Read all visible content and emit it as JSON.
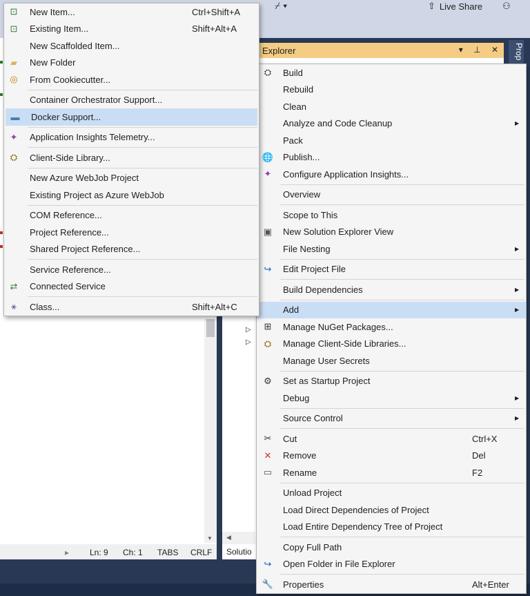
{
  "toolbar": {
    "live_share_label": "Live Share",
    "icons": [
      "live-share-icon",
      "person-icon",
      "toolbar-tool-icon"
    ]
  },
  "status_bar": {
    "ln": "Ln: 9",
    "ch": "Ch: 1",
    "tabs": "TABS",
    "crlf": "CRLF"
  },
  "solution_explorer": {
    "title": "Explorer",
    "tab_label": "Solutio",
    "controls": [
      "▾",
      "ᵽ",
      "✕"
    ]
  },
  "properties_tab": "Prop",
  "context_menu": {
    "items": [
      {
        "label": "Build",
        "icon": "build-icon"
      },
      {
        "label": "Rebuild"
      },
      {
        "label": "Clean"
      },
      {
        "label": "Analyze and Code Cleanup",
        "submenu": true
      },
      {
        "label": "Pack"
      },
      {
        "label": "Publish...",
        "icon": "globe-icon"
      },
      {
        "label": "Configure Application Insights...",
        "icon": "insights-icon"
      },
      {
        "sep": true
      },
      {
        "label": "Overview"
      },
      {
        "sep": true
      },
      {
        "label": "Scope to This"
      },
      {
        "label": "New Solution Explorer View",
        "icon": "new-window-icon"
      },
      {
        "label": "File Nesting",
        "submenu": true
      },
      {
        "sep": true
      },
      {
        "label": "Edit Project File",
        "icon": "edit-arrow-icon"
      },
      {
        "sep": true
      },
      {
        "label": "Build Dependencies",
        "submenu": true
      },
      {
        "sep": true
      },
      {
        "label": "Add",
        "submenu": true,
        "highlighted": true
      },
      {
        "label": "Manage NuGet Packages...",
        "icon": "nuget-icon"
      },
      {
        "label": "Manage Client-Side Libraries...",
        "icon": "library-icon"
      },
      {
        "label": "Manage User Secrets"
      },
      {
        "sep": true
      },
      {
        "label": "Set as Startup Project",
        "icon": "gear-icon"
      },
      {
        "label": "Debug",
        "submenu": true
      },
      {
        "sep": true
      },
      {
        "label": "Source Control",
        "submenu": true
      },
      {
        "sep": true
      },
      {
        "label": "Cut",
        "shortcut": "Ctrl+X",
        "icon": "scissors-icon"
      },
      {
        "label": "Remove",
        "shortcut": "Del",
        "icon": "remove-icon"
      },
      {
        "label": "Rename",
        "shortcut": "F2",
        "icon": "rename-icon"
      },
      {
        "sep": true
      },
      {
        "label": "Unload Project"
      },
      {
        "label": "Load Direct Dependencies of Project"
      },
      {
        "label": "Load Entire Dependency Tree of Project"
      },
      {
        "sep": true
      },
      {
        "label": "Copy Full Path"
      },
      {
        "label": "Open Folder in File Explorer",
        "icon": "open-folder-arrow-icon"
      },
      {
        "sep": true
      },
      {
        "label": "Properties",
        "shortcut": "Alt+Enter",
        "icon": "wrench-icon"
      }
    ]
  },
  "add_submenu": {
    "items": [
      {
        "label": "New Item...",
        "shortcut": "Ctrl+Shift+A",
        "icon": "new-item-icon"
      },
      {
        "label": "Existing Item...",
        "shortcut": "Shift+Alt+A",
        "icon": "existing-item-icon"
      },
      {
        "label": "New Scaffolded Item..."
      },
      {
        "label": "New Folder",
        "icon": "folder-icon"
      },
      {
        "label": "From Cookiecutter...",
        "icon": "cookiecutter-icon"
      },
      {
        "sep": true
      },
      {
        "label": "Container Orchestrator Support..."
      },
      {
        "label": "Docker Support...",
        "icon": "docker-icon",
        "highlighted": true
      },
      {
        "sep": true
      },
      {
        "label": "Application Insights Telemetry...",
        "icon": "insights-icon"
      },
      {
        "sep": true
      },
      {
        "label": "Client-Side Library...",
        "icon": "library-icon"
      },
      {
        "sep": true
      },
      {
        "label": "New Azure WebJob Project"
      },
      {
        "label": "Existing Project as Azure WebJob"
      },
      {
        "sep": true
      },
      {
        "label": "COM Reference..."
      },
      {
        "label": "Project Reference..."
      },
      {
        "label": "Shared Project Reference..."
      },
      {
        "sep": true
      },
      {
        "label": "Service Reference..."
      },
      {
        "label": "Connected Service",
        "icon": "connected-service-icon"
      },
      {
        "sep": true
      },
      {
        "label": "Class...",
        "shortcut": "Shift+Alt+C",
        "icon": "class-icon"
      }
    ]
  },
  "colors": {
    "menu_bg": "#f5f5f5",
    "highlight": "#c9def5",
    "title_bar": "#f5cc84",
    "ide_dark": "#293955"
  }
}
